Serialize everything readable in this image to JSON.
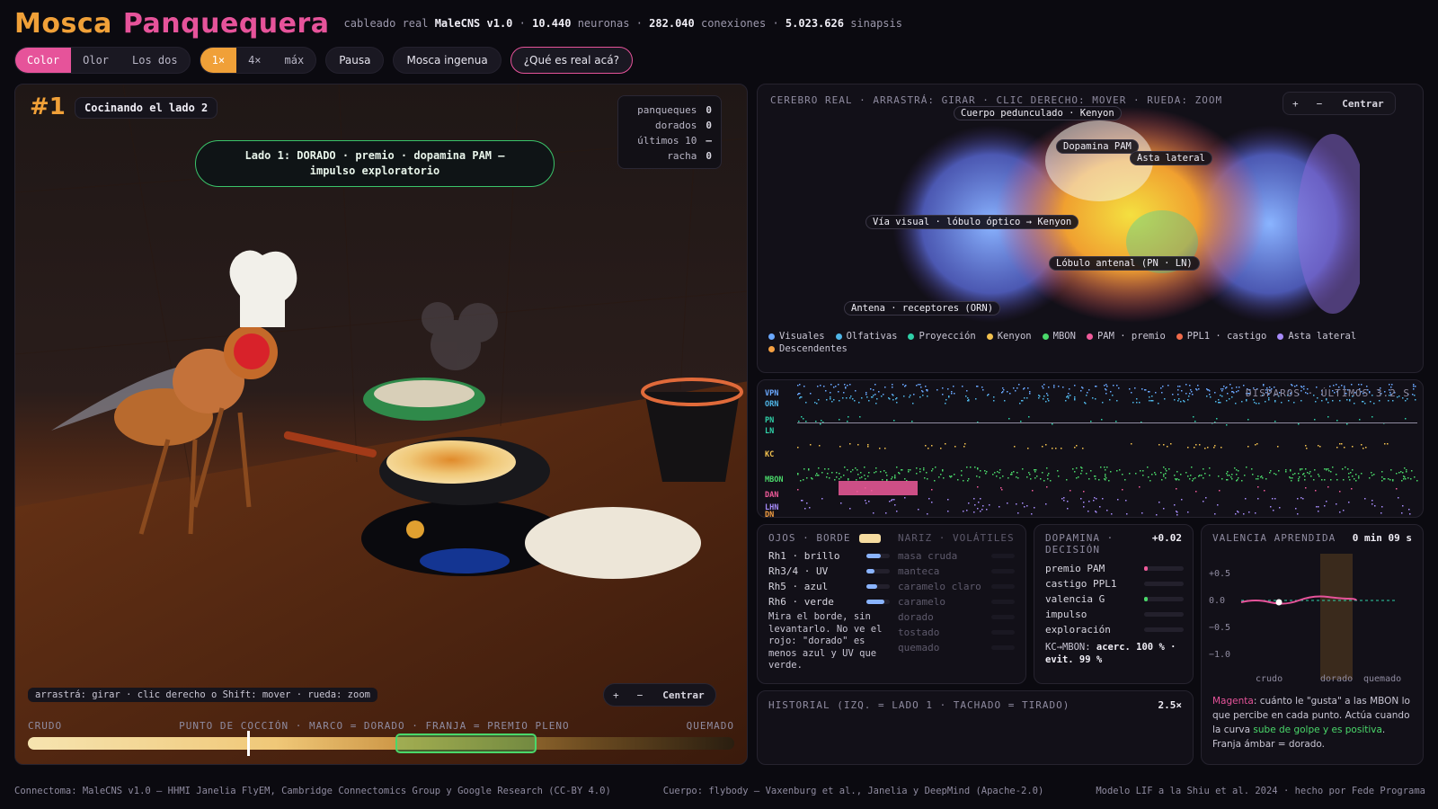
{
  "header": {
    "title_a": "Mosca",
    "title_b": "Panquequera",
    "stats": {
      "p1": "cableado real",
      "v1": "MaleCNS v1.0",
      "v2": "10.440",
      "p2": "neuronas",
      "v3": "282.040",
      "p3": "conexiones",
      "v4": "5.023.626",
      "p4": "sinapsis"
    }
  },
  "controls": {
    "mode": [
      "Color",
      "Olor",
      "Los dos"
    ],
    "speed": [
      "1×",
      "4×",
      "máx"
    ],
    "pause": "Pausa",
    "naive": "Mosca ingenua",
    "real": "¿Qué es real acá?"
  },
  "scene": {
    "episode": "#1",
    "status": "Cocinando el lado 2",
    "message": "Lado 1: DORADO · premio · dopamina PAM — impulso exploratorio",
    "score": {
      "l1": "panqueques",
      "v1": "0",
      "l2": "dorados",
      "v2": "0",
      "l3": "últimos 10",
      "v3": "—",
      "l4": "racha",
      "v4": "0"
    },
    "hint": "arrastrá: girar · clic derecho o Shift: mover · rueda: zoom",
    "zoom_in": "+",
    "zoom_out": "−",
    "center": "Centrar",
    "meter": {
      "left": "CRUDO",
      "mid": "PUNTO DE COCCIÓN · MARCO = DORADO · FRANJA = PREMIO PLENO",
      "right": "QUEMADO",
      "marker": 0.31,
      "gold_start": 0.52,
      "gold_end": 0.72
    }
  },
  "brain": {
    "title": "CEREBRO REAL · ARRASTRÁ: GIRAR · CLIC DERECHO: MOVER · RUEDA: ZOOM",
    "zoom_in": "+",
    "zoom_out": "−",
    "center": "Centrar",
    "labels": [
      "Cuerpo pedunculado · Kenyon",
      "Dopamina PAM",
      "Asta lateral",
      "Vía visual · lóbulo óptico → Kenyon",
      "Lóbulo antenal (PN · LN)",
      "Antena · receptores (ORN)"
    ],
    "legend": [
      {
        "name": "Visuales",
        "color": "#6aa8ff"
      },
      {
        "name": "Olfativas",
        "color": "#4fb6e8"
      },
      {
        "name": "Proyección",
        "color": "#2fd0a8"
      },
      {
        "name": "Kenyon",
        "color": "#f2c14e"
      },
      {
        "name": "MBON",
        "color": "#4ad86a"
      },
      {
        "name": "PAM · premio",
        "color": "#ef5a9a"
      },
      {
        "name": "PPL1 · castigo",
        "color": "#f06a4a"
      },
      {
        "name": "Asta lateral",
        "color": "#a78bfa"
      },
      {
        "name": "Descendentes",
        "color": "#f5a042"
      }
    ]
  },
  "raster": {
    "title": "DISPAROS · ÚLTIMOS 3.2 S",
    "rows": [
      "VPN",
      "ORN",
      "PN",
      "LN",
      "KC",
      "MBON",
      "DAN",
      "LHN",
      "DN"
    ]
  },
  "ojos": {
    "title": "OJOS · BORDE",
    "rows": [
      {
        "label": "Rh1 · brillo",
        "v": 0.6
      },
      {
        "label": "Rh3/4 · UV",
        "v": 0.35
      },
      {
        "label": "Rh5 · azul",
        "v": 0.45
      },
      {
        "label": "Rh6 · verde",
        "v": 0.75
      }
    ],
    "note": "Mira el borde, sin levantarlo. No ve el rojo: \"dorado\" es menos azul y UV que verde.",
    "nariz_title": "NARIZ · VOLÁTILES",
    "nariz": [
      "masa cruda",
      "manteca",
      "caramelo claro",
      "caramelo",
      "dorado",
      "tostado",
      "quemado"
    ]
  },
  "dopa": {
    "title": "DOPAMINA · DECISIÓN",
    "value": "+0.02",
    "rows": [
      {
        "label": "premio PAM",
        "v": 0.1,
        "c": "#ef5a9a"
      },
      {
        "label": "castigo PPL1",
        "v": 0.0,
        "c": "#f06a4a"
      },
      {
        "label": "valencia G",
        "v": 0.05,
        "c": "#4ad86a"
      },
      {
        "label": "impulso",
        "v": 0.0,
        "c": "#f2c14e"
      },
      {
        "label": "exploración",
        "v": 0.0,
        "c": "#6aa8ff"
      }
    ],
    "kc_l": "KC→MBON:",
    "kc_v": "acerc. 100 % · evit. 99 %"
  },
  "valencia": {
    "title": "VALENCIA APRENDIDA",
    "time": "0 min 09 s",
    "yticks": [
      "+0.5",
      "0.0",
      "−0.5",
      "−1.0"
    ],
    "xticks": [
      "crudo",
      "dorado",
      "quemado"
    ],
    "note_a": "Magenta",
    "note_b": ": cuánto le \"gusta\" a las MBON lo que percibe en cada punto. Actúa cuando la curva ",
    "note_c": "sube de golpe y es positiva",
    "note_d": ". Franja ámbar = dorado."
  },
  "historial": {
    "title": "HISTORIAL (IZQ. = LADO 1 · TACHADO = TIRADO)",
    "speed": "2.5×"
  },
  "footer": {
    "a": "Connectoma: MaleCNS v1.0 — HHMI Janelia FlyEM, Cambridge Connectomics Group y Google Research (CC-BY 4.0)",
    "b": "Cuerpo: flybody — Vaxenburg et al., Janelia y DeepMind (Apache-2.0)",
    "c": "Modelo LIF a la Shiu et al. 2024 · hecho por Fede Programa"
  }
}
